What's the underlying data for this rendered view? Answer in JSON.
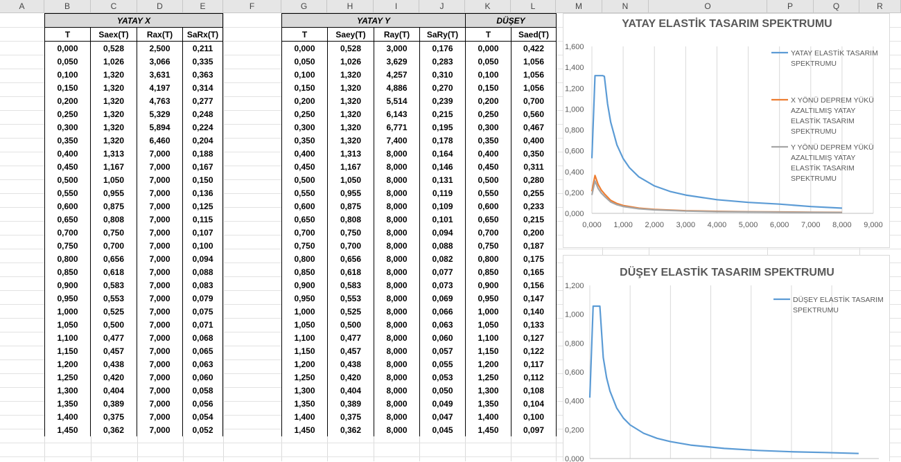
{
  "columns": [
    "A",
    "B",
    "C",
    "D",
    "E",
    "F",
    "G",
    "H",
    "I",
    "J",
    "K",
    "L",
    "M",
    "N",
    "O",
    "P",
    "Q",
    "R"
  ],
  "table_x": {
    "group": "YATAY X",
    "headers": [
      "T",
      "Saex(T)",
      "Rax(T)",
      "SaRx(T)"
    ],
    "rows": [
      [
        "0,000",
        "0,528",
        "2,500",
        "0,211"
      ],
      [
        "0,050",
        "1,026",
        "3,066",
        "0,335"
      ],
      [
        "0,100",
        "1,320",
        "3,631",
        "0,363"
      ],
      [
        "0,150",
        "1,320",
        "4,197",
        "0,314"
      ],
      [
        "0,200",
        "1,320",
        "4,763",
        "0,277"
      ],
      [
        "0,250",
        "1,320",
        "5,329",
        "0,248"
      ],
      [
        "0,300",
        "1,320",
        "5,894",
        "0,224"
      ],
      [
        "0,350",
        "1,320",
        "6,460",
        "0,204"
      ],
      [
        "0,400",
        "1,313",
        "7,000",
        "0,188"
      ],
      [
        "0,450",
        "1,167",
        "7,000",
        "0,167"
      ],
      [
        "0,500",
        "1,050",
        "7,000",
        "0,150"
      ],
      [
        "0,550",
        "0,955",
        "7,000",
        "0,136"
      ],
      [
        "0,600",
        "0,875",
        "7,000",
        "0,125"
      ],
      [
        "0,650",
        "0,808",
        "7,000",
        "0,115"
      ],
      [
        "0,700",
        "0,750",
        "7,000",
        "0,107"
      ],
      [
        "0,750",
        "0,700",
        "7,000",
        "0,100"
      ],
      [
        "0,800",
        "0,656",
        "7,000",
        "0,094"
      ],
      [
        "0,850",
        "0,618",
        "7,000",
        "0,088"
      ],
      [
        "0,900",
        "0,583",
        "7,000",
        "0,083"
      ],
      [
        "0,950",
        "0,553",
        "7,000",
        "0,079"
      ],
      [
        "1,000",
        "0,525",
        "7,000",
        "0,075"
      ],
      [
        "1,050",
        "0,500",
        "7,000",
        "0,071"
      ],
      [
        "1,100",
        "0,477",
        "7,000",
        "0,068"
      ],
      [
        "1,150",
        "0,457",
        "7,000",
        "0,065"
      ],
      [
        "1,200",
        "0,438",
        "7,000",
        "0,063"
      ],
      [
        "1,250",
        "0,420",
        "7,000",
        "0,060"
      ],
      [
        "1,300",
        "0,404",
        "7,000",
        "0,058"
      ],
      [
        "1,350",
        "0,389",
        "7,000",
        "0,056"
      ],
      [
        "1,400",
        "0,375",
        "7,000",
        "0,054"
      ],
      [
        "1,450",
        "0,362",
        "7,000",
        "0,052"
      ]
    ]
  },
  "table_y": {
    "group": "YATAY Y",
    "headers": [
      "T",
      "Saey(T)",
      "Ray(T)",
      "SaRy(T)"
    ],
    "rows": [
      [
        "0,000",
        "0,528",
        "3,000",
        "0,176"
      ],
      [
        "0,050",
        "1,026",
        "3,629",
        "0,283"
      ],
      [
        "0,100",
        "1,320",
        "4,257",
        "0,310"
      ],
      [
        "0,150",
        "1,320",
        "4,886",
        "0,270"
      ],
      [
        "0,200",
        "1,320",
        "5,514",
        "0,239"
      ],
      [
        "0,250",
        "1,320",
        "6,143",
        "0,215"
      ],
      [
        "0,300",
        "1,320",
        "6,771",
        "0,195"
      ],
      [
        "0,350",
        "1,320",
        "7,400",
        "0,178"
      ],
      [
        "0,400",
        "1,313",
        "8,000",
        "0,164"
      ],
      [
        "0,450",
        "1,167",
        "8,000",
        "0,146"
      ],
      [
        "0,500",
        "1,050",
        "8,000",
        "0,131"
      ],
      [
        "0,550",
        "0,955",
        "8,000",
        "0,119"
      ],
      [
        "0,600",
        "0,875",
        "8,000",
        "0,109"
      ],
      [
        "0,650",
        "0,808",
        "8,000",
        "0,101"
      ],
      [
        "0,700",
        "0,750",
        "8,000",
        "0,094"
      ],
      [
        "0,750",
        "0,700",
        "8,000",
        "0,088"
      ],
      [
        "0,800",
        "0,656",
        "8,000",
        "0,082"
      ],
      [
        "0,850",
        "0,618",
        "8,000",
        "0,077"
      ],
      [
        "0,900",
        "0,583",
        "8,000",
        "0,073"
      ],
      [
        "0,950",
        "0,553",
        "8,000",
        "0,069"
      ],
      [
        "1,000",
        "0,525",
        "8,000",
        "0,066"
      ],
      [
        "1,050",
        "0,500",
        "8,000",
        "0,063"
      ],
      [
        "1,100",
        "0,477",
        "8,000",
        "0,060"
      ],
      [
        "1,150",
        "0,457",
        "8,000",
        "0,057"
      ],
      [
        "1,200",
        "0,438",
        "8,000",
        "0,055"
      ],
      [
        "1,250",
        "0,420",
        "8,000",
        "0,053"
      ],
      [
        "1,300",
        "0,404",
        "8,000",
        "0,050"
      ],
      [
        "1,350",
        "0,389",
        "8,000",
        "0,049"
      ],
      [
        "1,400",
        "0,375",
        "8,000",
        "0,047"
      ],
      [
        "1,450",
        "0,362",
        "8,000",
        "0,045"
      ]
    ]
  },
  "table_z": {
    "group": "DÜŞEY",
    "headers": [
      "T",
      "Saed(T)"
    ],
    "rows": [
      [
        "0,000",
        "0,422"
      ],
      [
        "0,050",
        "1,056"
      ],
      [
        "0,100",
        "1,056"
      ],
      [
        "0,150",
        "1,056"
      ],
      [
        "0,200",
        "0,700"
      ],
      [
        "0,250",
        "0,560"
      ],
      [
        "0,300",
        "0,467"
      ],
      [
        "0,350",
        "0,400"
      ],
      [
        "0,400",
        "0,350"
      ],
      [
        "0,450",
        "0,311"
      ],
      [
        "0,500",
        "0,280"
      ],
      [
        "0,550",
        "0,255"
      ],
      [
        "0,600",
        "0,233"
      ],
      [
        "0,650",
        "0,215"
      ],
      [
        "0,700",
        "0,200"
      ],
      [
        "0,750",
        "0,187"
      ],
      [
        "0,800",
        "0,175"
      ],
      [
        "0,850",
        "0,165"
      ],
      [
        "0,900",
        "0,156"
      ],
      [
        "0,950",
        "0,147"
      ],
      [
        "1,000",
        "0,140"
      ],
      [
        "1,050",
        "0,133"
      ],
      [
        "1,100",
        "0,127"
      ],
      [
        "1,150",
        "0,122"
      ],
      [
        "1,200",
        "0,117"
      ],
      [
        "1,250",
        "0,112"
      ],
      [
        "1,300",
        "0,108"
      ],
      [
        "1,350",
        "0,104"
      ],
      [
        "1,400",
        "0,100"
      ],
      [
        "1,450",
        "0,097"
      ]
    ]
  },
  "chart_data": [
    {
      "type": "line",
      "title": "YATAY ELASTİK TASARIM SPEKTRUMU",
      "xlim": [
        0,
        9
      ],
      "ylim": [
        0,
        1.6
      ],
      "xticks": [
        "0,000",
        "1,000",
        "2,000",
        "3,000",
        "4,000",
        "5,000",
        "6,000",
        "7,000",
        "8,000",
        "9,000"
      ],
      "yticks": [
        "0,000",
        "0,200",
        "0,400",
        "0,600",
        "0,800",
        "1,000",
        "1,200",
        "1,400",
        "1,600"
      ],
      "grid": "vertical",
      "legend_position": "right",
      "series": [
        {
          "name": "YATAY ELASTİK TASARIM SPEKTRUMU",
          "color": "#5b9bd5",
          "x": [
            0,
            0.1,
            0.35,
            0.4,
            0.5,
            0.6,
            0.8,
            1.0,
            1.2,
            1.5,
            2,
            2.5,
            3,
            4,
            5,
            6,
            7,
            8
          ],
          "y": [
            0.528,
            1.32,
            1.32,
            1.313,
            1.05,
            0.875,
            0.656,
            0.525,
            0.438,
            0.35,
            0.263,
            0.21,
            0.175,
            0.131,
            0.105,
            0.088,
            0.065,
            0.05
          ]
        },
        {
          "name": "X YÖNÜ DEPREM YÜKÜ AZALTILMIŞ YATAY ELASTİK TASARIM SPEKTRUMU",
          "color": "#ed7d31",
          "x": [
            0,
            0.1,
            0.2,
            0.3,
            0.4,
            0.6,
            0.8,
            1.0,
            1.5,
            2,
            3,
            4,
            5,
            6,
            7,
            8
          ],
          "y": [
            0.211,
            0.363,
            0.277,
            0.224,
            0.188,
            0.125,
            0.094,
            0.075,
            0.05,
            0.038,
            0.025,
            0.019,
            0.015,
            0.013,
            0.011,
            0.009
          ]
        },
        {
          "name": "Y YÖNÜ DEPREM YÜKÜ AZALTILMIŞ YATAY ELASTİK TASARIM SPEKTRUMU",
          "color": "#a5a5a5",
          "x": [
            0,
            0.1,
            0.2,
            0.3,
            0.4,
            0.6,
            0.8,
            1.0,
            1.5,
            2,
            3,
            4,
            5,
            6,
            7,
            8
          ],
          "y": [
            0.176,
            0.31,
            0.239,
            0.195,
            0.164,
            0.109,
            0.082,
            0.066,
            0.044,
            0.033,
            0.022,
            0.016,
            0.013,
            0.011,
            0.009,
            0.008
          ]
        }
      ]
    },
    {
      "type": "line",
      "title": "DÜŞEY ELASTİK TASARIM SPEKTRUMU",
      "ylim": [
        0,
        1.2
      ],
      "yticks": [
        "0,000",
        "0,200",
        "0,400",
        "0,600",
        "0,800",
        "1,000",
        "1,200"
      ],
      "grid": "vertical",
      "legend_position": "top-right",
      "series": [
        {
          "name": "DÜŞEY ELASTİK TASARIM SPEKTRUMU",
          "color": "#5b9bd5",
          "x": [
            0,
            0.05,
            0.1,
            0.15,
            0.2,
            0.25,
            0.3,
            0.4,
            0.5,
            0.6,
            0.8,
            1.0,
            1.2,
            1.5,
            2,
            2.5,
            3,
            3.5,
            4.0
          ],
          "y": [
            0.422,
            1.056,
            1.056,
            1.056,
            0.7,
            0.56,
            0.467,
            0.35,
            0.28,
            0.233,
            0.175,
            0.14,
            0.117,
            0.093,
            0.07,
            0.056,
            0.047,
            0.042,
            0.035
          ]
        }
      ]
    }
  ]
}
